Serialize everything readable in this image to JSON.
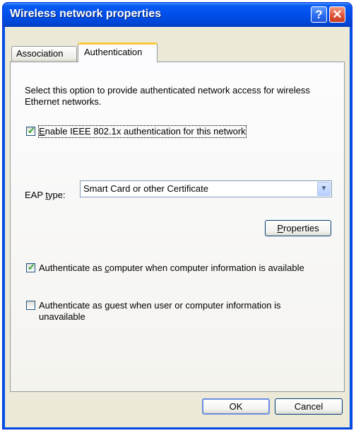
{
  "window": {
    "title": "Wireless network properties",
    "help_glyph": "?",
    "close_glyph": "✕"
  },
  "tabs": [
    {
      "label": "Association",
      "selected": false
    },
    {
      "label": "Authentication",
      "selected": true
    }
  ],
  "auth": {
    "description": "Select this option to provide authenticated network access for wireless Ethernet networks.",
    "enable_8021x": {
      "pre": "",
      "key": "E",
      "post": "nable IEEE 802.1x authentication for this network",
      "checked": true
    },
    "eap_label": {
      "pre": "EAP ",
      "key": "t",
      "post": "ype:"
    },
    "eap_value": "Smart Card or other Certificate",
    "properties_button": {
      "pre": "",
      "key": "P",
      "post": "roperties"
    },
    "auth_computer": {
      "pre": "Authenticate as ",
      "key": "c",
      "post": "omputer when computer information is available",
      "checked": true
    },
    "auth_guest": {
      "pre": "Authenticate as ",
      "key": "g",
      "post": "uest when user or computer information is",
      "line2": "unavailable",
      "checked": false
    }
  },
  "footer": {
    "ok_label": "OK",
    "cancel_label": "Cancel"
  }
}
